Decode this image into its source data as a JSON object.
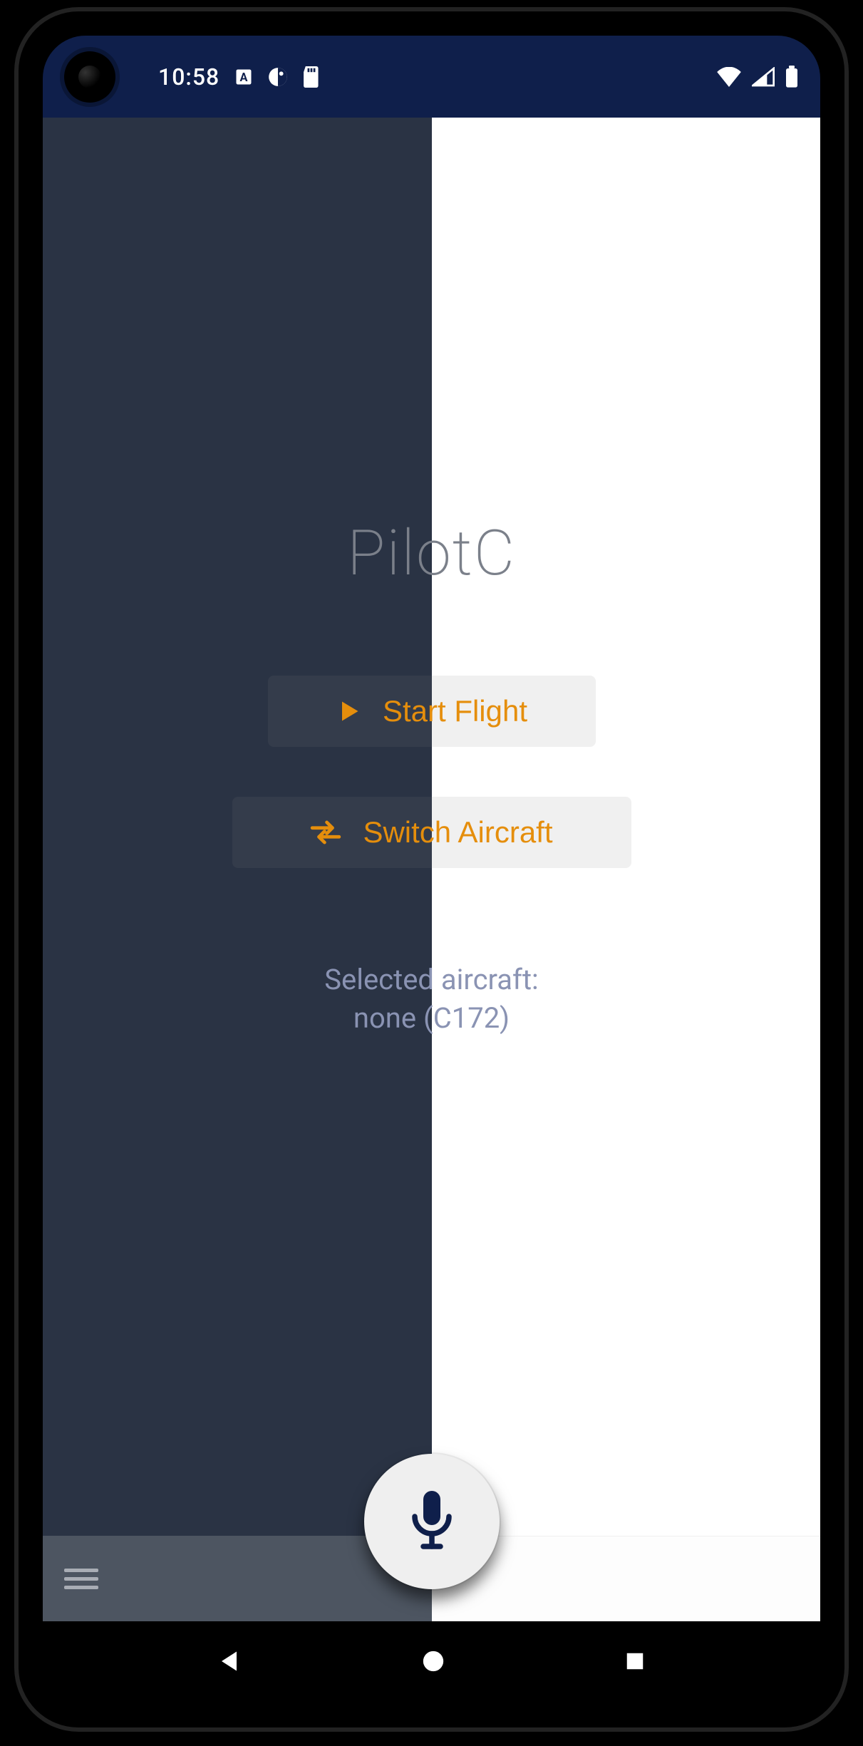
{
  "status": {
    "time": "10:58"
  },
  "app": {
    "title": "PilotC",
    "start_flight_label": "Start Flight",
    "switch_aircraft_label": "Switch Aircraft",
    "selected_label": "Selected aircraft:",
    "selected_value": "none (C172)"
  },
  "colors": {
    "accent": "#e58e0c",
    "dark_panel": "#2a3344",
    "light_panel": "#ffffff",
    "status_bg": "#0f1f4b"
  }
}
